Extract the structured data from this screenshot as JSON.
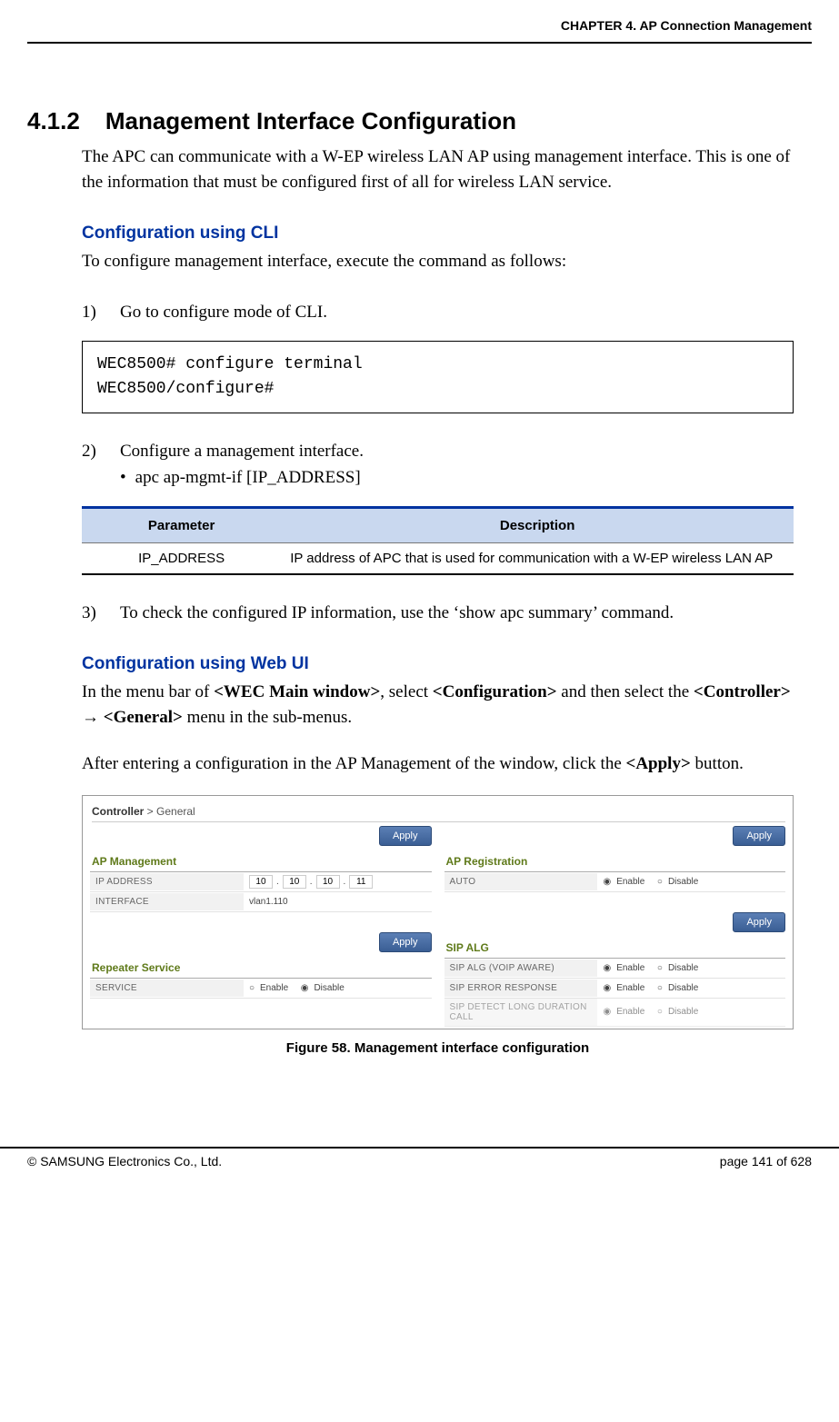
{
  "header": {
    "chapter": "CHAPTER 4. AP Connection Management"
  },
  "section": {
    "number": "4.1.2",
    "title": "Management Interface Configuration"
  },
  "intro": "The APC can communicate with a W-EP wireless LAN AP using management interface. This is one of the information that must be configured first of all for wireless LAN service.",
  "cli_heading": "Configuration using CLI",
  "cli_intro": "To configure management interface, execute the command as follows:",
  "steps": {
    "s1_num": "1)",
    "s1_text": "Go to configure mode of CLI.",
    "code": "WEC8500# configure terminal\nWEC8500/configure#",
    "s2_num": "2)",
    "s2_text": "Configure a management interface.",
    "s2_bullet_dot": "•",
    "s2_bullet": "apc ap-mgmt-if [IP_ADDRESS]",
    "s3_num": "3)",
    "s3_text": "To check the configured IP information, use the ‘show apc summary’ command."
  },
  "param_table": {
    "h1": "Parameter",
    "h2": "Description",
    "r1c1": "IP_ADDRESS",
    "r1c2": "IP address of APC that is used for communication with a W-EP wireless LAN AP"
  },
  "web_heading": "Configuration using Web UI",
  "web_text_1a": "In the menu bar of ",
  "web_text_1b": "<WEC Main window>",
  "web_text_1c": ", select ",
  "web_text_1d": "<Configuration>",
  "web_text_1e": " and then select the ",
  "web_text_1f": "<Controller>",
  "web_text_1g": " → ",
  "web_text_1h": "<General>",
  "web_text_1i": " menu in the sub-menus.",
  "web_text_2a": "After entering a configuration in the AP Management of the window, click the ",
  "web_text_2b": "<Apply>",
  "web_text_2c": " button.",
  "screenshot": {
    "breadcrumb_a": "Controller",
    "breadcrumb_sep": " > ",
    "breadcrumb_b": "General",
    "apply_btn": "Apply",
    "left": {
      "panel1": "AP Management",
      "ip_label": "IP ADDRESS",
      "ip": [
        "10",
        "10",
        "10",
        "11"
      ],
      "iface_label": "INTERFACE",
      "iface_val": "vlan1.110",
      "panel2": "Repeater Service",
      "svc_label": "SERVICE",
      "enable": "Enable",
      "disable": "Disable"
    },
    "right": {
      "panel1": "AP Registration",
      "auto_label": "AUTO",
      "panel2": "SIP ALG",
      "r1": "SIP ALG (VOIP AWARE)",
      "r2": "SIP ERROR RESPONSE",
      "r3": "SIP DETECT LONG DURATION CALL",
      "enable": "Enable",
      "disable": "Disable"
    }
  },
  "figure_caption": "Figure 58. Management interface configuration",
  "footer": {
    "left": "© SAMSUNG Electronics Co., Ltd.",
    "right": "page 141 of 628"
  }
}
